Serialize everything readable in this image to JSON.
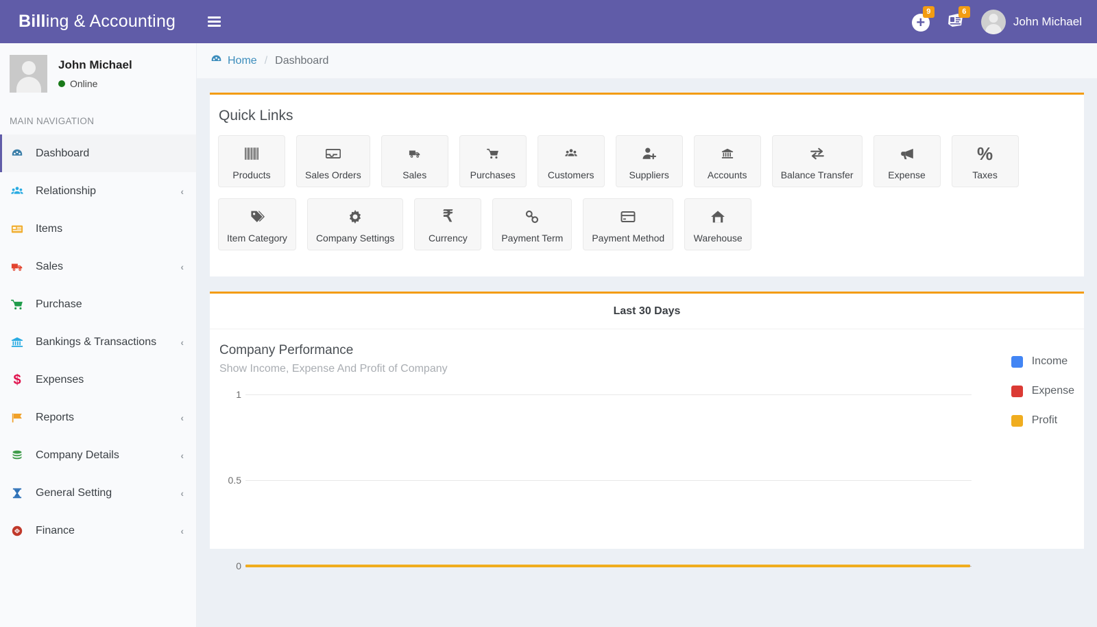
{
  "header": {
    "brand_bold": "Bill",
    "brand_rest": "ing & Accounting",
    "menu_icon": "hamburger-icon",
    "add_icon": "plus-circle-icon",
    "add_badge": "9",
    "messages_icon": "envelope-newspaper-icon",
    "messages_badge": "6",
    "user_name": "John Michael",
    "bg_color": "#605ca8",
    "badge_color": "#f39c12"
  },
  "sidebar": {
    "profile": {
      "name": "John Michael",
      "status": "Online",
      "status_color": "#1a7a1a"
    },
    "nav_header": "MAIN NAVIGATION",
    "items": [
      {
        "label": "Dashboard",
        "icon": "dashboard-icon",
        "icon_color": "#3b7ea8",
        "active": true,
        "expandable": false
      },
      {
        "label": "Relationship",
        "icon": "users-group-icon",
        "icon_color": "#29abe2",
        "active": false,
        "expandable": true
      },
      {
        "label": "Items",
        "icon": "list-card-icon",
        "icon_color": "#f0ad2e",
        "active": false,
        "expandable": false
      },
      {
        "label": "Sales",
        "icon": "delivery-truck-icon",
        "icon_color": "#e2442f",
        "active": false,
        "expandable": true
      },
      {
        "label": "Purchase",
        "icon": "shopping-cart-icon",
        "icon_color": "#1f9c4a",
        "active": false,
        "expandable": false
      },
      {
        "label": "Bankings & Transactions",
        "icon": "bank-icon",
        "icon_color": "#29abe2",
        "active": false,
        "expandable": true
      },
      {
        "label": "Expenses",
        "icon": "dollar-sign-icon",
        "icon_color": "#e0114c",
        "active": false,
        "expandable": false
      },
      {
        "label": "Reports",
        "icon": "flag-icon",
        "icon_color": "#f0a028",
        "active": false,
        "expandable": true
      },
      {
        "label": "Company Details",
        "icon": "database-icon",
        "icon_color": "#3f9c4a",
        "active": false,
        "expandable": true
      },
      {
        "label": "General Setting",
        "icon": "hourglass-icon",
        "icon_color": "#2f72b8",
        "active": false,
        "expandable": true
      },
      {
        "label": "Finance",
        "icon": "finance-badge-icon",
        "icon_color": "#c0392b",
        "active": false,
        "expandable": true
      }
    ],
    "chevron": "‹"
  },
  "breadcrumb": {
    "home_label": "Home",
    "home_icon": "dashboard-icon",
    "separator": "/",
    "current": "Dashboard",
    "link_color": "#3c8dbc"
  },
  "quick_links": {
    "title": "Quick Links",
    "accent_color": "#f39c12",
    "row1": [
      {
        "label": "Products",
        "icon": "barcode-icon"
      },
      {
        "label": "Sales Orders",
        "icon": "inbox-tray-icon"
      },
      {
        "label": "Sales",
        "icon": "delivery-truck-icon"
      },
      {
        "label": "Purchases",
        "icon": "shopping-cart-icon"
      },
      {
        "label": "Customers",
        "icon": "users-group-icon"
      },
      {
        "label": "Suppliers",
        "icon": "user-plus-icon"
      },
      {
        "label": "Accounts",
        "icon": "bank-icon"
      },
      {
        "label": "Balance Transfer",
        "icon": "exchange-arrows-icon"
      },
      {
        "label": "Expense",
        "icon": "megaphone-icon"
      },
      {
        "label": "Taxes",
        "icon": "percent-icon"
      }
    ],
    "row2": [
      {
        "label": "Item Category",
        "icon": "tags-icon"
      },
      {
        "label": "Company Settings",
        "icon": "gear-icon"
      },
      {
        "label": "Currency",
        "icon": "rupee-icon"
      },
      {
        "label": "Payment Term",
        "icon": "chain-link-icon"
      },
      {
        "label": "Payment Method",
        "icon": "credit-card-icon"
      },
      {
        "label": "Warehouse",
        "icon": "home-icon"
      }
    ]
  },
  "chart_panel": {
    "period_label": "Last 30 Days",
    "accent_color": "#f39c12"
  },
  "chart_data": {
    "type": "line",
    "title": "Company Performance",
    "subtitle": "Show Income, Expense And Profit of Company",
    "xlabel": "",
    "ylabel": "",
    "ylim": [
      0,
      1
    ],
    "ytick_labels": [
      "1",
      "0.5",
      "0"
    ],
    "ytick_values": [
      1,
      0.5,
      0
    ],
    "grid": true,
    "legend_position": "right",
    "x": [
      0,
      1
    ],
    "series": [
      {
        "name": "Income",
        "color": "#4285f4",
        "values": [
          0,
          0
        ]
      },
      {
        "name": "Expense",
        "color": "#db3a34",
        "values": [
          0,
          0
        ]
      },
      {
        "name": "Profit",
        "color": "#f0ad1f",
        "values": [
          0,
          0
        ]
      }
    ]
  }
}
